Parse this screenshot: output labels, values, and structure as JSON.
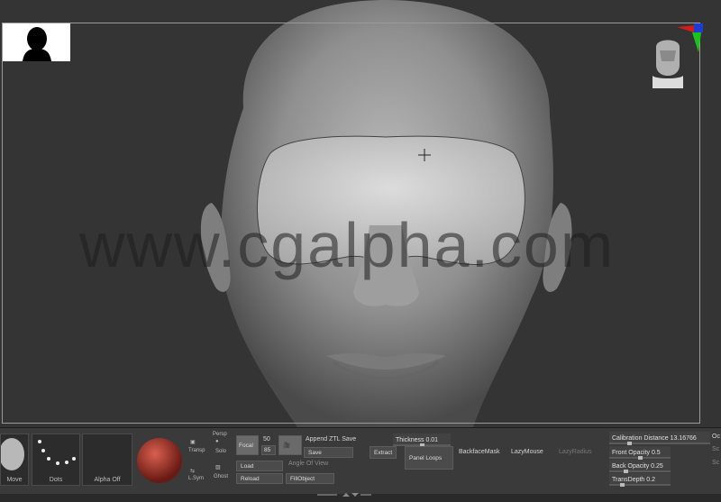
{
  "watermark": "www.cgalpha.com",
  "shelf": {
    "brush_label": "Move",
    "stroke_label": "Dots",
    "alpha_label": "Alpha Off",
    "transp_label": "Transp",
    "persp_label": "Persp",
    "solo_label": "Solo",
    "lsym_label": "L.Sym",
    "ghost_label": "Ghost",
    "focal_label": "Focal",
    "persp_value": "50",
    "persp_value2": "85",
    "append_label": "Append ZTL Save",
    "save_label": "Save",
    "load_label": "Load",
    "reload_label": "Reload",
    "angle_label": "Angle Of View",
    "fill_label": "FillObject",
    "thickness_label": "Thickness 0.01",
    "extract_label": "Extract",
    "panel_loops_label": "Panel Loops",
    "backface_label": "BackfaceMask",
    "lazymouse_label": "LazyMouse",
    "lazyradius_label": "LazyRadius",
    "calibration_label": "Calibration Distance",
    "calibration_value": "13.16766",
    "front_opacity_label": "Front Opacity 0.5",
    "back_opacity_label": "Back Opacity 0.25",
    "trans_depth_label": "TransDepth 0.2",
    "right_cut1": "Oc",
    "right_cut2": "Sc",
    "right_cut3": "Sc"
  },
  "colors": {
    "material_red": "#9a2a22",
    "panel_bg": "#3a3a3a"
  }
}
